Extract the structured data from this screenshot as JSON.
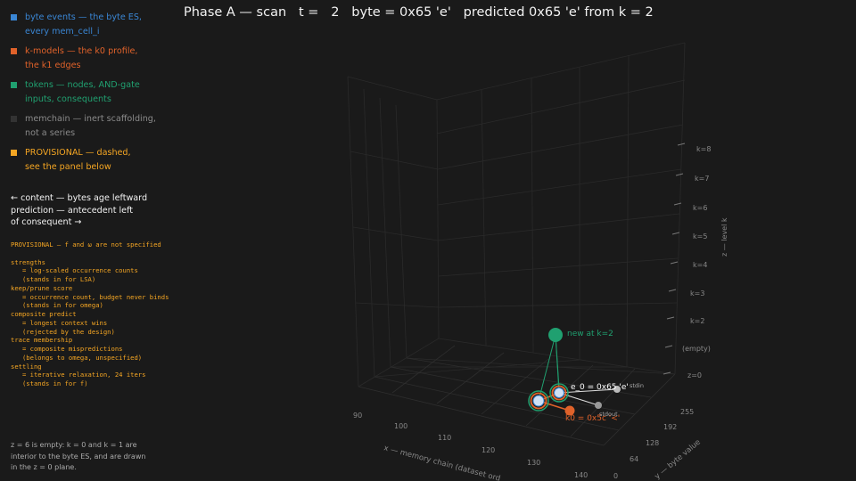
{
  "title": "Phase A — scan   t =   2   byte = 0x65 'e'   predicted 0x65 'e' from k = 2",
  "legend": [
    {
      "color": "#3a86d4",
      "line1": "byte events — the byte ES,",
      "line2": "every mem_cell_i"
    },
    {
      "color": "#e0622a",
      "line1": "k-models — the k0 profile,",
      "line2": "the k1 edges"
    },
    {
      "color": "#20a070",
      "line1": "tokens — nodes, AND-gate",
      "line2": "inputs, consequents"
    },
    {
      "color": "#333333",
      "line1": "memchain — inert scaffolding,",
      "line2": "not a series"
    },
    {
      "color": "#f5a623",
      "line1": "PROVISIONAL — dashed,",
      "line2": "see the panel below"
    }
  ],
  "direction": {
    "line1": "←  content — bytes age leftward",
    "line2": "prediction — antecedent left",
    "line3": "of consequent  →"
  },
  "provisional": "PROVISIONAL — f and ω are not specified\n\nstrengths\n   = log-scaled occurrence counts\n   (stands in for LSA)\nkeep/prune score\n   = occurrence count, budget never binds\n   (stands in for omega)\ncomposite predict\n   = longest context wins\n   (rejected by the design)\ntrace membership\n   = composite mispredictions\n   (belongs to omega, unspecified)\nsettling\n   = iterative relaxation, 24 iters\n   (stands in for f)",
  "footnote": {
    "line1": "z = 6 is empty: k = 0 and k = 1 are",
    "line2": "interior to the byte ES, and are drawn",
    "line3": "in the z = 0 plane."
  },
  "axes": {
    "x_label": "x — memory chain (dataset ord",
    "x_ticks": [
      "90",
      "100",
      "110",
      "120",
      "130",
      "140"
    ],
    "y_label": "y — byte value",
    "y_ticks": [
      "0",
      "64",
      "128",
      "192",
      "255"
    ],
    "z_label": "z — level k",
    "z_ticks": [
      "z=0",
      "(empty)",
      "k=2",
      "k=3",
      "k=4",
      "k=5",
      "k=6",
      "k=7",
      "k=8"
    ]
  },
  "annotations": {
    "new_node": "new at k=2",
    "e0": "e_0 = 0x65 'e'",
    "k0": "k0 = 0x5c '<'",
    "stdin": "stdin",
    "stdout": "stdout"
  },
  "colors": {
    "byte": "#3a86d4",
    "kmodel": "#e0622a",
    "token": "#20a070",
    "provisional": "#f5a623",
    "background": "#1a1a1a"
  }
}
